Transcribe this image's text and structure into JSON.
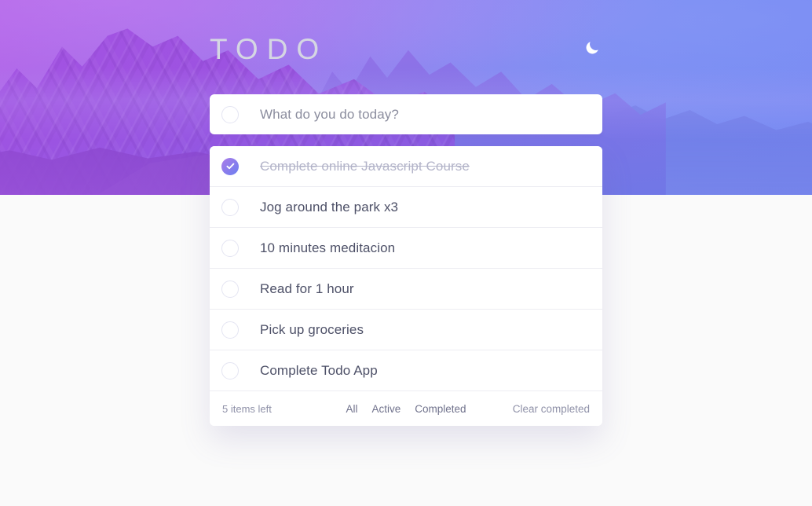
{
  "header": {
    "title": "TODO",
    "theme_toggle_icon": "moon-icon"
  },
  "new_todo": {
    "placeholder": "What do you do today?",
    "value": ""
  },
  "todos": [
    {
      "label": "Complete online Javascript Course",
      "completed": true
    },
    {
      "label": "Jog around the park x3",
      "completed": false
    },
    {
      "label": "10 minutes meditacion",
      "completed": false
    },
    {
      "label": "Read for 1 hour",
      "completed": false
    },
    {
      "label": "Pick up groceries",
      "completed": false
    },
    {
      "label": "Complete Todo App",
      "completed": false
    }
  ],
  "footer": {
    "items_left": "5 items left",
    "filters": [
      "All",
      "Active",
      "Completed"
    ],
    "clear_completed": "Clear completed"
  },
  "colors": {
    "page_background": "#fafafa",
    "card_background": "#ffffff",
    "title": "#d5d6e3",
    "text": "#4d5067",
    "completed_text": "#b3b4c9",
    "muted": "#8f91a8",
    "check_gradient_start": "#ab7ce8",
    "check_gradient_end": "#6b7ef0",
    "hero_left": "#b06ae8",
    "hero_right": "#7b8ef2"
  }
}
